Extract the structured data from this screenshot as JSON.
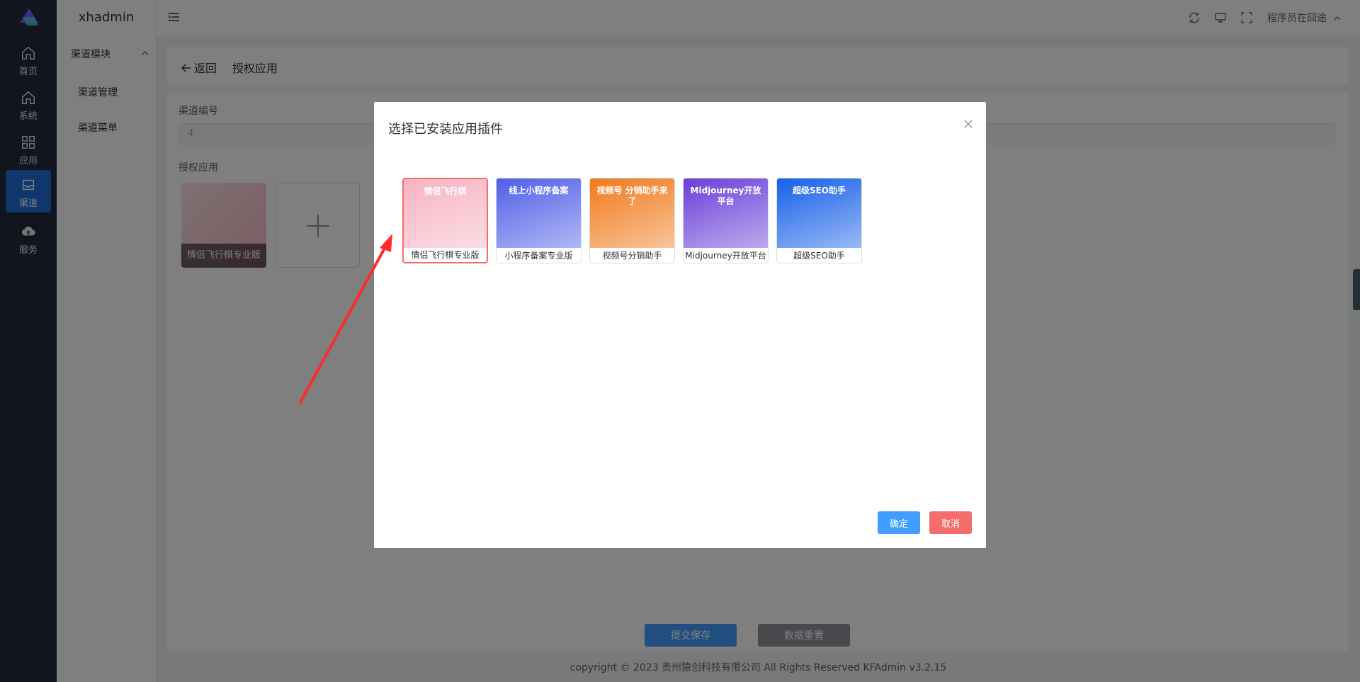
{
  "rail": {
    "items": [
      {
        "label": "首页",
        "icon": "home-icon"
      },
      {
        "label": "系统",
        "icon": "home-icon"
      },
      {
        "label": "应用",
        "icon": "grid-icon"
      },
      {
        "label": "渠道",
        "icon": "inbox-icon"
      },
      {
        "label": "服务",
        "icon": "cloud-upload-icon"
      }
    ],
    "active_index": 3
  },
  "subnav": {
    "brand": "xhadmin",
    "group": "渠道模块",
    "items": [
      "渠道管理",
      "渠道菜单"
    ]
  },
  "topbar": {
    "icons": [
      "refresh-icon",
      "monitor-icon",
      "fullscreen-icon"
    ],
    "user": "程序员在囧途"
  },
  "page": {
    "back_label": "返回",
    "title": "授权应用"
  },
  "form": {
    "channel_no_label": "渠道编号",
    "channel_no_value": "4",
    "apps_label": "授权应用",
    "apps": [
      {
        "name": "情侣飞行棋专业版"
      }
    ],
    "submit_label": "提交保存",
    "reset_label": "数据重置"
  },
  "footer": "copyright © 2023   贵州猿创科技有限公司 All Rights Reserved   KFAdmin v3.2.15",
  "modal": {
    "title": "选择已安装应用插件",
    "ok_label": "确定",
    "cancel_label": "取消",
    "plugins": [
      {
        "name": "情侣飞行棋专业版",
        "banner": "情侣飞行棋",
        "color": "#f7b3c2",
        "selected": true
      },
      {
        "name": "小程序备案专业版",
        "banner": "线上小程序备案",
        "color": "#4f5fe8",
        "selected": false
      },
      {
        "name": "视频号分销助手",
        "banner": "视频号 分销助手来了",
        "color": "#f07a1a",
        "selected": false
      },
      {
        "name": "Midjourney开放平台",
        "banner": "Midjourney开放平台",
        "color": "#6a3fd8",
        "selected": false
      },
      {
        "name": "超级SEO助手",
        "banner": "超级SEO助手",
        "color": "#1760e8",
        "selected": false
      }
    ]
  },
  "colors": {
    "primary": "#409eff",
    "danger": "#f56c6c",
    "rail_bg": "#222b3a",
    "rail_active": "#1e6fd9"
  }
}
